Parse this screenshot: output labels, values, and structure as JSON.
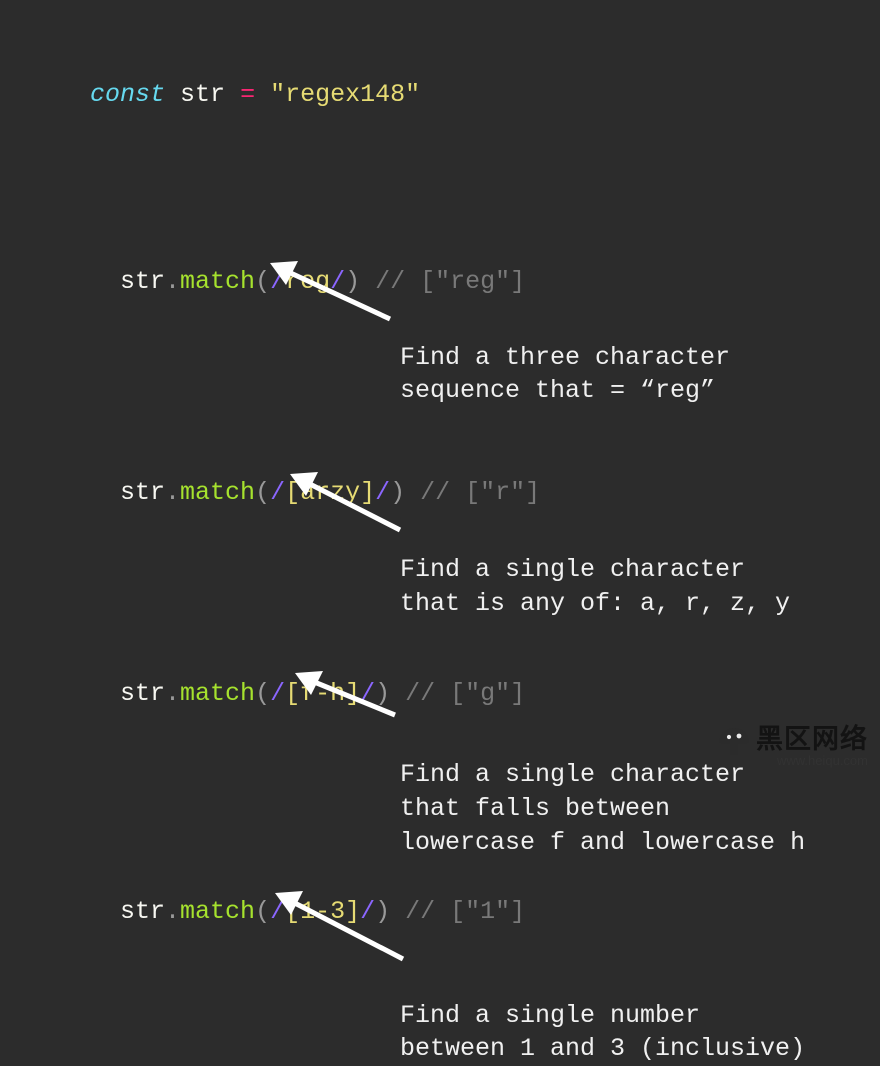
{
  "decl": {
    "keyword": "const",
    "ident": "str",
    "eq": "=",
    "value": "\"regex148\""
  },
  "sections": [
    {
      "obj": "str",
      "fn": "match",
      "pattern": "reg",
      "comment": "// [\"reg\"]",
      "explain": "Find a three character\nsequence that = “reg”"
    },
    {
      "obj": "str",
      "fn": "match",
      "pattern": "[arzy]",
      "comment": "// [\"r\"]",
      "explain": "Find a single character\nthat is any of: a, r, z, y"
    },
    {
      "obj": "str",
      "fn": "match",
      "pattern": "[f-h]",
      "comment": "// [\"g\"]",
      "explain": "Find a single character\nthat falls between\nlowercase f and lowercase h"
    },
    {
      "obj": "str",
      "fn": "match",
      "pattern": "[1-3]",
      "comment": "// [\"1\"]",
      "explain": "Find a single number\nbetween 1 and 3 (inclusive)"
    }
  ],
  "watermark": {
    "title": "黑区网络",
    "sub": "www.heiqu.com"
  }
}
